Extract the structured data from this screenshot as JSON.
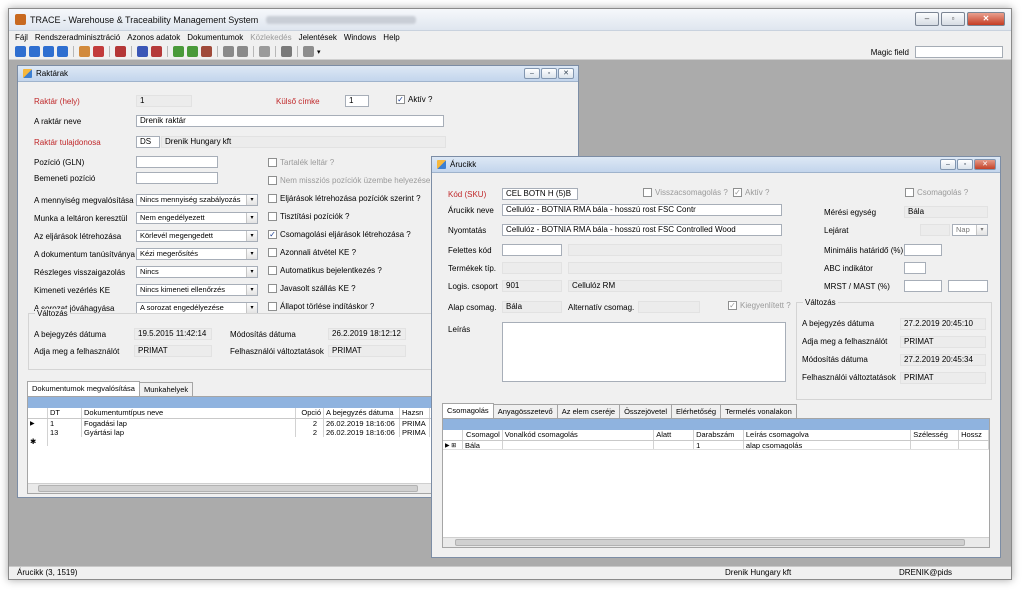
{
  "app": {
    "title": "TRACE - Warehouse & Traceability Management System",
    "menu": [
      "Fájl",
      "Rendszeradminisztráció",
      "Azonos adatok",
      "Dokumentumok",
      "Közlekedés",
      "Jelentések",
      "Windows",
      "Help"
    ],
    "magic_label": "Magic field",
    "status": {
      "left": "Árucikk (3, 1519)",
      "company": "Drenik Hungary kft",
      "user": "DRENIK@pids"
    }
  },
  "raktar": {
    "title": "Raktárak",
    "raktar_hely_label": "Raktár (hely)",
    "raktar_hely": "1",
    "kulso_cimke_label": "Külső címke",
    "kulso_cimke": "1",
    "aktiv_label": "Aktív ?",
    "neve_label": "A raktár neve",
    "neve": "Drenik raktár",
    "tulajdonos_label": "Raktár tulajdonosa",
    "tulajdonos_kod": "DS",
    "tulajdonos_nev": "Drenik Hungary kft",
    "pozicio_label": "Pozíció (GLN)",
    "bemeneti_label": "Bemeneti pozíció",
    "left_rows": [
      {
        "label": "A mennyiség megvalósítása",
        "value": "Nincs mennyiség szabályozás"
      },
      {
        "label": "Munka a leltáron keresztül",
        "value": "Nem engedélyezett"
      },
      {
        "label": "Az eljárások létrehozása",
        "value": "Körlevél megengedett"
      },
      {
        "label": "A dokumentum tanúsítványa",
        "value": "Kézi megerősítés"
      },
      {
        "label": "Részleges visszaigazolás",
        "value": "Nincs"
      },
      {
        "label": "Kimeneti vezérlés KE",
        "value": "Nincs kimeneti ellenőrzés"
      },
      {
        "label": "A sorozat jóváhagyása",
        "value": "A sorozat engedélyezése"
      }
    ],
    "checks": [
      {
        "label": "Tartalék leltár ?",
        "checked": false,
        "dim": true
      },
      {
        "label": "Nem missziós pozíciók üzembe helyezése ?",
        "checked": false,
        "dim": true
      },
      {
        "label": "Eljárások létrehozása pozíciók szerint ?",
        "checked": false,
        "dim": false
      },
      {
        "label": "Tisztítási pozíciók ?",
        "checked": false,
        "dim": false
      },
      {
        "label": "Csomagolási eljárások létrehozása ?",
        "checked": true,
        "dim": false
      },
      {
        "label": "Azonnali átvétel KE ?",
        "checked": false,
        "dim": false
      },
      {
        "label": "Automatikus bejelentkezés ?",
        "checked": false,
        "dim": false
      },
      {
        "label": "Javasolt szállás KE ?",
        "checked": false,
        "dim": false
      },
      {
        "label": "Állapot törlése indításkor ?",
        "checked": false,
        "dim": false
      }
    ],
    "valtozas_label": "Változás",
    "bejegyzes_label": "A bejegyzés dátuma",
    "bejegyzes": "19.5.2015 11:42:14",
    "felhasznalo_label": "Adja meg a felhasználót",
    "felhasznalo": "PRIMAT",
    "modositas_label": "Módosítás dátuma",
    "modositas": "26.2.2019 18:12:12",
    "valtoztatasok_label": "Felhasználói változtatások",
    "valtoztatasok": "PRIMAT",
    "tabs": [
      "Dokumentumok megvalósítása",
      "Munkahelyek"
    ],
    "grid_headers": [
      "DT",
      "Dokumentumtípus neve",
      "Opció",
      "A bejegyzés dátuma",
      "Hazsn"
    ],
    "grid_rows": [
      [
        "1",
        "Fogadási lap",
        "2",
        "26.02.2019 18:16:06",
        "PRIMA"
      ],
      [
        "13",
        "Gyártási lap",
        "2",
        "26.02.2019 18:16:06",
        "PRIMA"
      ]
    ],
    "row_markers": [
      "▶",
      "",
      "✱"
    ]
  },
  "arucikk": {
    "title": "Árucikk",
    "kod_label": "Kód (SKU)",
    "kod": "CEL BOTN H (5)B",
    "visszacsom_label": "Visszacsomagolás ?",
    "aktiv_label": "Aktív ?",
    "csomagolas_label": "Csomagolás ?",
    "neve_label": "Árucikk neve",
    "neve": "Cellulóz - BOTNIA RMA bála - hosszú rost FSC Contr",
    "nyomtatas_label": "Nyomtatás",
    "nyomtatas": "Cellulóz - BOTNIA RMA bála - hosszú rost FSC Controlled Wood",
    "felettes_label": "Felettes kód",
    "termek_label": "Termékek típ.",
    "logis_label": "Logis. csoport",
    "logis_kod": "901",
    "logis_nev": "Cellulóz RM",
    "alap_label": "Alap csomag.",
    "alap": "Bála",
    "alternativ_label": "Alternatív csomag.",
    "kiegyenlitett_label": "Kiegyenlített ?",
    "leiras_label": "Leírás",
    "meresi_label": "Mérési egység",
    "meresi": "Bála",
    "lejarat_label": "Lejárat",
    "lejarat_unit": "Nap",
    "minimalis_label": "Minimális határidő (%)",
    "abc_label": "ABC indikátor",
    "mrst_label": "MRST / MAST (%)",
    "valtozas_label": "Változás",
    "bejegyzes_label": "A bejegyzés dátuma",
    "bejegyzes": "27.2.2019 20:45:10",
    "felhasznalo_label": "Adja meg a felhasználót",
    "felhasznalo": "PRIMAT",
    "modositas_label": "Módosítás dátuma",
    "modositas": "27.2.2019 20:45:34",
    "valtoztatasok_label": "Felhasználói változtatások",
    "valtoztatasok": "PRIMAT",
    "tabs": [
      "Csomagolás",
      "Anyagösszetevő",
      "Az elem cseréje",
      "Összejövetel",
      "Elérhetőség",
      "Termelés vonalakon"
    ],
    "grid_headers": [
      "Csomagol",
      "Vonalkód csomagolás",
      "Alatt",
      "Darabszám",
      "Leírás csomagolva",
      "Szélesség",
      "Hossz"
    ],
    "grid_row": [
      "Bála",
      "",
      "",
      "1",
      "alap csomagolás",
      "",
      ""
    ],
    "row_marker": "▶ ⊞"
  }
}
